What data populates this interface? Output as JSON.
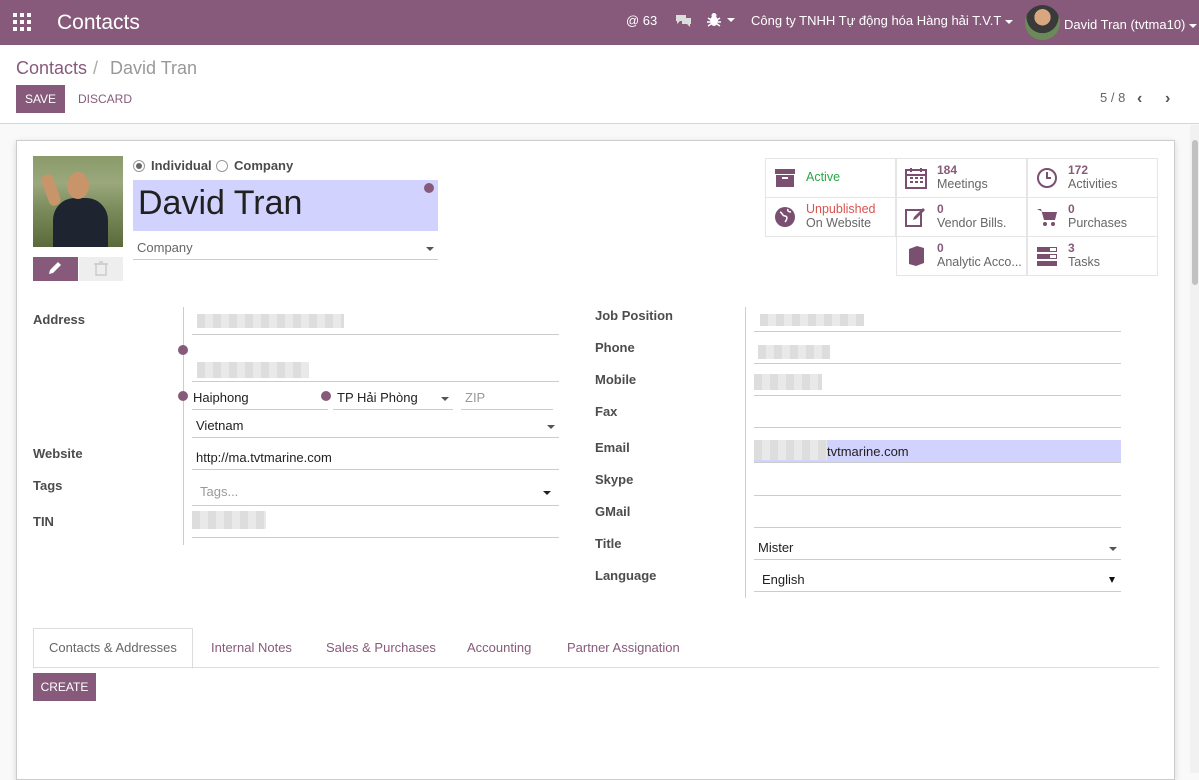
{
  "topbar": {
    "app_title": "Contacts",
    "mentions": "@ 63",
    "company": "Công ty TNHH Tự động hóa Hàng hải T.V.T",
    "user": "David Tran (tvtma10)"
  },
  "control": {
    "breadcrumb_parent": "Contacts",
    "breadcrumb_sep": "/",
    "breadcrumb_current": "David Tran",
    "save_label": "SAVE",
    "discard_label": "DISCARD",
    "pager": "5 / 8"
  },
  "form": {
    "type_individual": "Individual",
    "type_company": "Company",
    "name": "David Tran",
    "company_placeholder": "Company",
    "labels": {
      "address": "Address",
      "website": "Website",
      "tags": "Tags",
      "tin": "TIN",
      "job_position": "Job Position",
      "phone": "Phone",
      "mobile": "Mobile",
      "fax": "Fax",
      "email": "Email",
      "skype": "Skype",
      "gmail": "GMail",
      "title": "Title",
      "language": "Language"
    },
    "city": "Haiphong",
    "state": "TP Hải Phòng",
    "zip_placeholder": "ZIP",
    "country": "Vietnam",
    "website": "http://ma.tvtmarine.com",
    "tags_placeholder": "Tags...",
    "email_suffix": "tvtmarine.com",
    "title": "Mister",
    "language": "English"
  },
  "stats": [
    {
      "num": "",
      "label1": "Active",
      "label2": "",
      "icon": "archive-icon"
    },
    {
      "num": "184",
      "label1": "Meetings",
      "icon": "calendar-icon"
    },
    {
      "num": "172",
      "label1": "Activities",
      "icon": "clock-icon"
    },
    {
      "num": "",
      "label1": "Unpublished",
      "label2": "On Website",
      "icon": "globe-icon"
    },
    {
      "num": "0",
      "label1": "Vendor Bills.",
      "icon": "pencil-square-icon"
    },
    {
      "num": "0",
      "label1": "Purchases",
      "icon": "cart-icon"
    },
    {
      "num": "0",
      "label1": "Analytic Acco...",
      "icon": "book-icon"
    },
    {
      "num": "3",
      "label1": "Tasks",
      "icon": "tasks-icon"
    }
  ],
  "tabs": [
    "Contacts & Addresses",
    "Internal Notes",
    "Sales & Purchases",
    "Accounting",
    "Partner Assignation"
  ],
  "create_label": "CREATE",
  "colors": {
    "brand": "#875a7b",
    "active": "#28a745",
    "unpublished": "#d9534f"
  }
}
